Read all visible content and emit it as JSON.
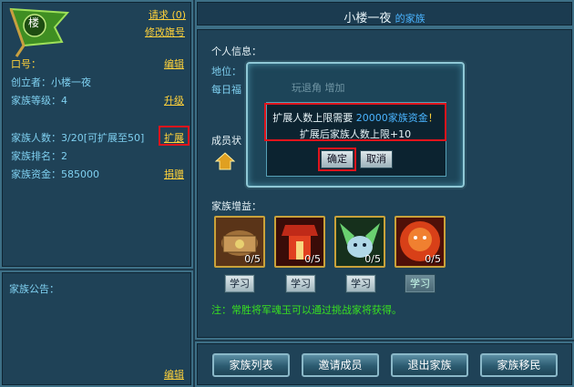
{
  "left": {
    "flag_char": "楼",
    "request_link": "请求 (0)",
    "edit_flag_link": "修改旗号",
    "slogan_label": "口号：",
    "slogan_edit": "编辑",
    "founder": "创立者：小楼一夜",
    "level": "家族等级：4",
    "upgrade": "升级",
    "members": "家族人数：3/20[可扩展至50]",
    "expand": "扩展",
    "rank": "家族排名：2",
    "funds": "家族资金：585000",
    "donate": "捐赠",
    "notice_label": "家族公告：",
    "notice_edit": "编辑"
  },
  "header": {
    "title": "小楼一夜",
    "suffix": "的家族"
  },
  "main": {
    "personal_info": "个人信息：",
    "position": "地位：",
    "daily": "每日福",
    "member_status": "成员状",
    "bonus_label": "家族增益：",
    "skills": [
      {
        "name": "chest-skill",
        "count": "0/5",
        "learn": "学习"
      },
      {
        "name": "altar-skill",
        "count": "0/5",
        "learn": "学习"
      },
      {
        "name": "wolf-skill",
        "count": "0/5",
        "learn": "学习"
      },
      {
        "name": "fire-general-skill",
        "count": "0/5",
        "learn": "学习"
      }
    ],
    "note": "注：常胜将军魂玉可以通过挑战家将获得。"
  },
  "bottom_buttons": [
    "家族列表",
    "邀请成员",
    "退出家族",
    "家族移民"
  ],
  "dialog": {
    "line1_prefix": "扩展人数上限需要 ",
    "line1_amount": "20000家族资金",
    "line1_suffix": "！",
    "line2": "扩展后家族人数上限+10",
    "ok": "确定",
    "cancel": "取消",
    "faded_tabs": "玩退角 增加"
  },
  "colors": {
    "gold": "#ffd23a",
    "highlight_red": "#e0141c",
    "cyan": "#7fd0f0",
    "green_note": "#38e020"
  }
}
